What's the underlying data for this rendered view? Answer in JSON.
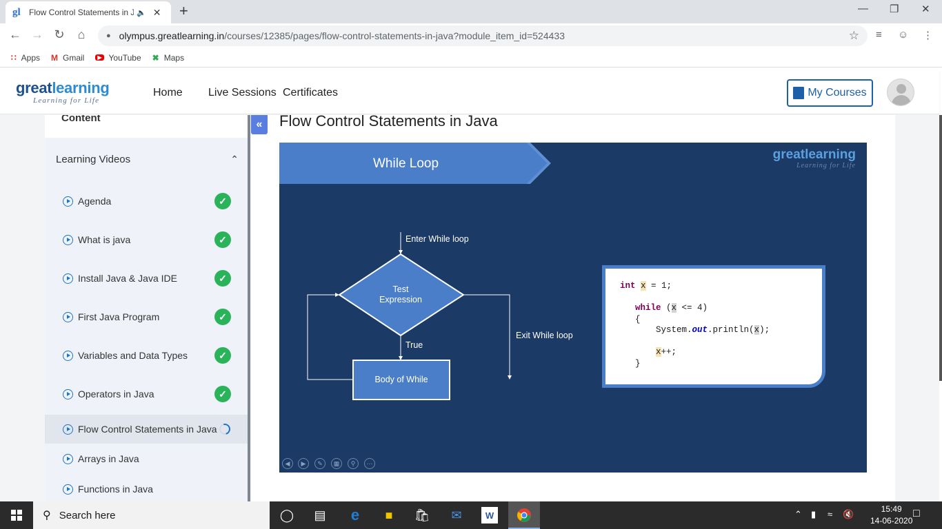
{
  "browser": {
    "tab_title": "Flow Control Statements in J",
    "favicon": "gl",
    "url_host": "olympus.greatlearning.in",
    "url_path": "/courses/12385/pages/flow-control-statements-in-java?module_item_id=524433",
    "bookmarks": [
      {
        "label": "Apps",
        "icon": "apps-grid-icon"
      },
      {
        "label": "Gmail",
        "icon": "gmail-icon"
      },
      {
        "label": "YouTube",
        "icon": "youtube-icon"
      },
      {
        "label": "Maps",
        "icon": "maps-icon"
      }
    ]
  },
  "site": {
    "logo_main": "great",
    "logo_accent": "learning",
    "logo_tagline": "Learning for Life",
    "nav": [
      "Home",
      "Live Sessions",
      "Certificates"
    ],
    "my_courses": "My Courses",
    "brand_color": "#1d5fa8"
  },
  "sidebar": {
    "content_header": "Content",
    "group_title": "Learning Videos",
    "items": [
      {
        "label": "Agenda",
        "status": "done"
      },
      {
        "label": "What is java",
        "status": "done"
      },
      {
        "label": "Install Java & Java IDE",
        "status": "done"
      },
      {
        "label": "First Java Program",
        "status": "done"
      },
      {
        "label": "Variables and Data Types",
        "status": "done"
      },
      {
        "label": "Operators in Java",
        "status": "done"
      },
      {
        "label": "Flow Control Statements in Java",
        "status": "in-progress"
      },
      {
        "label": "Arrays in Java",
        "status": "none"
      },
      {
        "label": "Functions in Java",
        "status": "none"
      }
    ],
    "done_color": "#2ab35b"
  },
  "lesson": {
    "title": "Flow Control Statements in Java"
  },
  "video": {
    "banner": "While Loop",
    "logo_main": "greatlearning",
    "logo_tagline": "Learning for Life",
    "flow": {
      "enter": "Enter While loop",
      "test_line1": "Test",
      "test_line2": "Expression",
      "true_label": "True",
      "body": "Body of While",
      "exit": "Exit While loop"
    },
    "code": {
      "l1_kw": "int",
      "l1_var": "x",
      "l1_rest": " = 1;",
      "l2_kw": "while",
      "l2_a": " (",
      "l2_var": "x",
      "l2_b": " <= 4)",
      "l3": "{",
      "l4_a": "System.",
      "l4_field": "out",
      "l4_b": ".println(",
      "l4_var": "x",
      "l4_c": ");",
      "l5_var": "x",
      "l5_rest": "++;",
      "l6": "}"
    }
  },
  "taskbar": {
    "search_placeholder": "Search here",
    "time": "15:49",
    "date": "14-06-2020"
  }
}
